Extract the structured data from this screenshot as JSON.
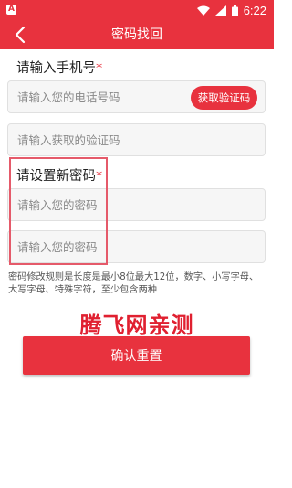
{
  "status_bar": {
    "time": "6:22",
    "app_icon_letter": "A",
    "icons": [
      "wifi-icon",
      "signal-icon",
      "battery-icon"
    ]
  },
  "header": {
    "title": "密码找回",
    "back_icon": "chevron-left-icon"
  },
  "phone_section": {
    "label": "请输入手机号",
    "required_mark": "*",
    "phone_placeholder": "请输入您的电话号码",
    "get_code_label": "获取验证码",
    "code_placeholder": "请输入获取的验证码"
  },
  "password_section": {
    "label": "请设置新密码",
    "required_mark": "*",
    "password_placeholder": "请输入您的密码",
    "confirm_placeholder": "请输入您的密码"
  },
  "rules_text": "密码修改规则是长度是最小8位最大12位，数字、小写字母、大写字母、特殊字符，至少包含两种",
  "watermark": "腾飞网亲测",
  "confirm_label": "确认重置",
  "colors": {
    "brand": "#e8323e",
    "field_bg": "#f6f6f6",
    "highlight": "#e55a6a"
  }
}
